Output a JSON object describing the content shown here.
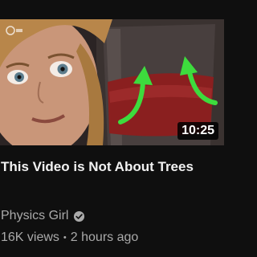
{
  "video": {
    "title": "This Video is Not About Trees",
    "duration": "10:25",
    "channel": "Physics Girl",
    "views": "16K views",
    "separator": "•",
    "age": "2 hours ago"
  },
  "icons": {
    "verified": "verified-check-icon",
    "channel_logo": "channel-watermark-icon"
  },
  "colors": {
    "background": "#0f0f0f",
    "title": "#f1f1f1",
    "meta": "#aaaaaa",
    "arrow": "#3ddc3d",
    "liquid": "#8a1f1f"
  }
}
